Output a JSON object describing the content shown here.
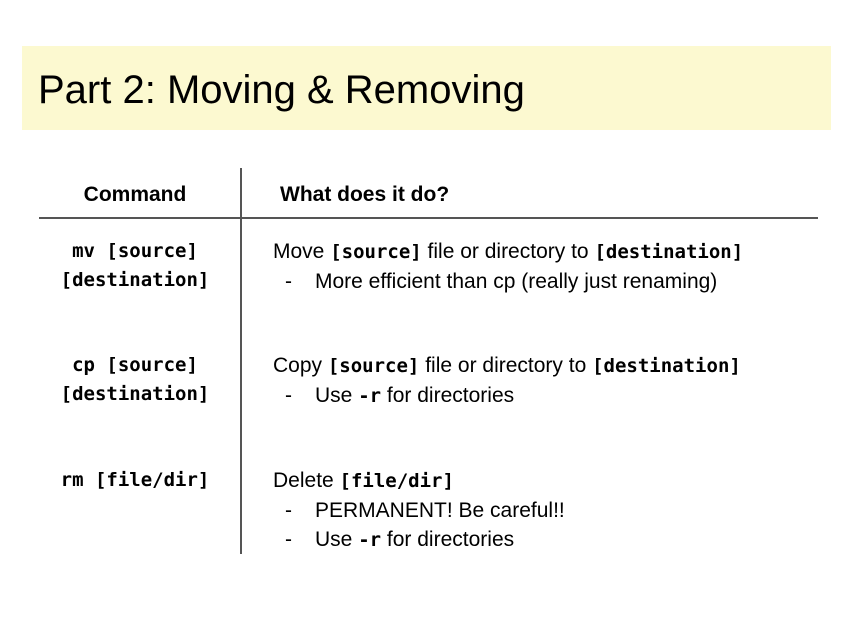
{
  "title": "Part 2: Moving & Removing",
  "table": {
    "header_command": "Command",
    "header_description": "What does it do?",
    "rows": [
      {
        "command_line1": "mv [source]",
        "command_line2": "[destination]",
        "desc_prefix": "Move ",
        "desc_code1": "[source]",
        "desc_middle": " file or directory to ",
        "desc_code2": "[destination]",
        "bullets": [
          {
            "dash": "-",
            "text": "More efficient than cp (really just renaming)"
          }
        ]
      },
      {
        "command_line1": "cp [source]",
        "command_line2": "[destination]",
        "desc_prefix": "Copy ",
        "desc_code1": "[source]",
        "desc_middle": " file or directory to ",
        "desc_code2": "[destination]",
        "bullets": [
          {
            "dash": "-",
            "pre": "Use ",
            "code": "-r",
            "post": " for directories"
          }
        ]
      },
      {
        "command_line1": "rm [file/dir]",
        "desc_prefix": "Delete ",
        "desc_code1": "[file/dir]",
        "bullets": [
          {
            "dash": "-",
            "text": "PERMANENT! Be careful!!"
          },
          {
            "dash": "-",
            "pre": "Use ",
            "code": "-r",
            "post": " for directories"
          }
        ]
      }
    ]
  },
  "colors": {
    "title_background": "#fcf9d0",
    "rule": "#555555",
    "text": "#000000"
  }
}
